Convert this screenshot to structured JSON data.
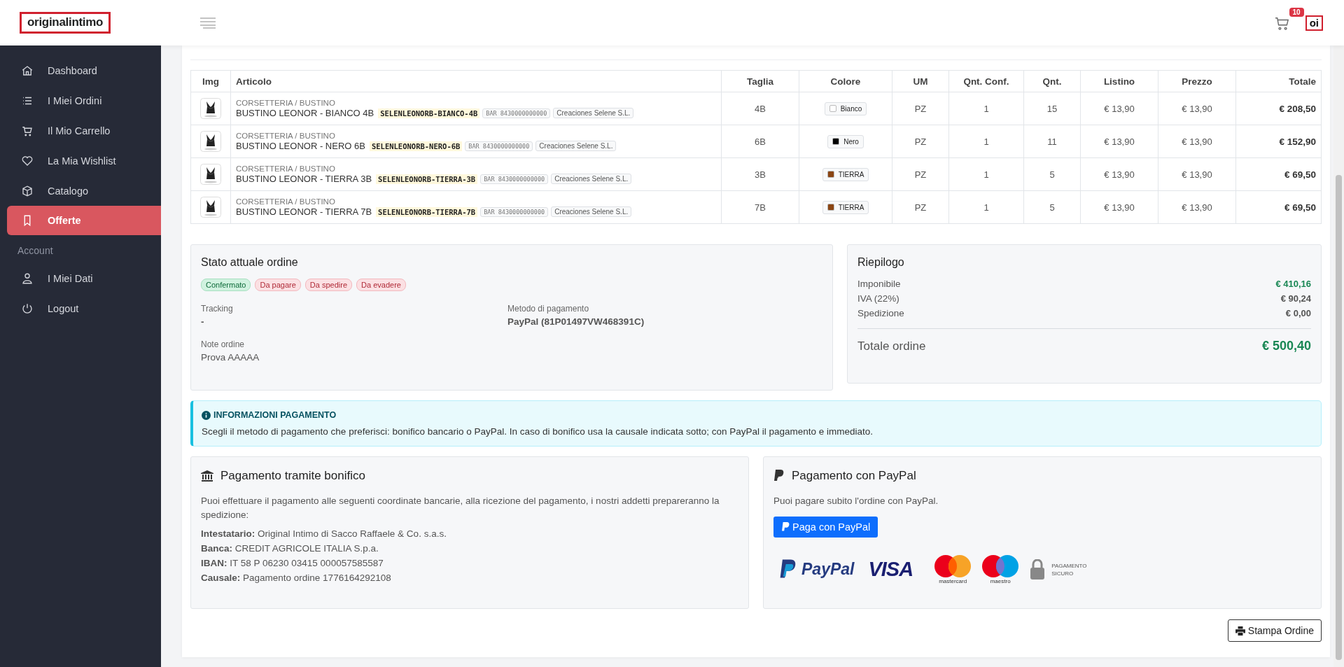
{
  "header": {
    "logo": "originalintimo",
    "cart_count": "10",
    "avatar": "oi"
  },
  "sidebar": {
    "items": [
      {
        "label": "Dashboard",
        "selected": false
      },
      {
        "label": "I Miei Ordini",
        "selected": false
      },
      {
        "label": "Il Mio Carrello",
        "selected": false
      },
      {
        "label": "La Mia Wishlist",
        "selected": false
      },
      {
        "label": "Catalogo",
        "selected": false
      },
      {
        "label": "Offerte",
        "selected": true
      }
    ],
    "section": "Account",
    "account_items": [
      {
        "label": "I Miei Dati",
        "selected": false
      },
      {
        "label": "Logout",
        "selected": false
      }
    ]
  },
  "table": {
    "columns": [
      "Img",
      "Articolo",
      "Taglia",
      "Colore",
      "UM",
      "Qnt. Conf.",
      "Qnt.",
      "Listino",
      "Prezzo",
      "Totale"
    ],
    "rows": [
      {
        "category": "CORSETTERIA / BUSTINO",
        "name": "BUSTINO LEONOR - BIANCO 4B",
        "sku": "SELENLEONORB-BIANCO-4B",
        "barcode": "BAR 8430000000000",
        "supplier": "Creaciones Selene S.L.",
        "size": "4B",
        "color_name": "Bianco",
        "color": "#ffffff",
        "um": "PZ",
        "pack_qty": "1",
        "qty": "15",
        "list_price": "€ 13,90",
        "price": "€ 13,90",
        "total": "€ 208,50"
      },
      {
        "category": "CORSETTERIA / BUSTINO",
        "name": "BUSTINO LEONOR - NERO 6B",
        "sku": "SELENLEONORB-NERO-6B",
        "barcode": "BAR 8430000000000",
        "supplier": "Creaciones Selene S.L.",
        "size": "6B",
        "color_name": "Nero",
        "color": "#000000",
        "um": "PZ",
        "pack_qty": "1",
        "qty": "11",
        "list_price": "€ 13,90",
        "price": "€ 13,90",
        "total": "€ 152,90"
      },
      {
        "category": "CORSETTERIA / BUSTINO",
        "name": "BUSTINO LEONOR - TIERRA 3B",
        "sku": "SELENLEONORB-TIERRA-3B",
        "barcode": "BAR 8430000000000",
        "supplier": "Creaciones Selene S.L.",
        "size": "3B",
        "color_name": "TIERRA",
        "color": "#8b4513",
        "um": "PZ",
        "pack_qty": "1",
        "qty": "5",
        "list_price": "€ 13,90",
        "price": "€ 13,90",
        "total": "€ 69,50"
      },
      {
        "category": "CORSETTERIA / BUSTINO",
        "name": "BUSTINO LEONOR - TIERRA 7B",
        "sku": "SELENLEONORB-TIERRA-7B",
        "barcode": "BAR 8430000000000",
        "supplier": "Creaciones Selene S.L.",
        "size": "7B",
        "color_name": "TIERRA",
        "color": "#8b4513",
        "um": "PZ",
        "pack_qty": "1",
        "qty": "5",
        "list_price": "€ 13,90",
        "price": "€ 13,90",
        "total": "€ 69,50"
      }
    ]
  },
  "status": {
    "title": "Stato attuale ordine",
    "badges": [
      {
        "label": "Confermato",
        "kind": "success"
      },
      {
        "label": "Da pagare",
        "kind": "danger"
      },
      {
        "label": "Da spedire",
        "kind": "danger"
      },
      {
        "label": "Da evadere",
        "kind": "danger"
      }
    ],
    "tracking_label": "Tracking",
    "tracking": "-",
    "payment_label": "Metodo di pagamento",
    "payment": "PayPal (81P01497VW468391C)",
    "notes_label": "Note ordine",
    "notes": "Prova AAAAA"
  },
  "summary": {
    "title": "Riepilogo",
    "lines": [
      {
        "label": "Imponibile",
        "value": "€ 410,16",
        "kind": "positive"
      },
      {
        "label": "IVA (22%)",
        "value": "€ 90,24",
        "kind": "plain"
      },
      {
        "label": "Spedizione",
        "value": "€ 0,00",
        "kind": "plain"
      }
    ],
    "total_label": "Totale ordine",
    "total": "€ 500,40"
  },
  "alert": {
    "title": "INFORMAZIONI PAGAMENTO",
    "text": "Scegli il metodo di pagamento che preferisci: bonifico bancario o PayPal. In caso di bonifico usa la causale indicata sotto; con PayPal il pagamento e immediato."
  },
  "bank": {
    "title": "Pagamento tramite bonifico",
    "intro": "Puoi effettuare il pagamento alle seguenti coordinate bancarie, alla ricezione del pagamento, i nostri addetti prepareranno la spedizione:",
    "details": [
      "**Intestatario:** Original Intimo di Sacco Raffaele & Co. s.a.s.",
      "**Banca:** CREDIT AGRICOLE ITALIA S.p.a.",
      "**IBAN:** IT 58 P 06230 03415 000057585587",
      "**Causale:** Pagamento ordine 1776164292108"
    ]
  },
  "paypal": {
    "title": "Pagamento con PayPal",
    "text": "Puoi pagare subito l'ordine con PayPal.",
    "button": "Paga con PayPal",
    "logos": {
      "paypal": "PayPal",
      "visa": "VISA",
      "mastercard": "mastercard",
      "maestro": "maestro",
      "secure": "PAGAMENTO SICURO"
    }
  },
  "print_button": "Stampa Ordine"
}
